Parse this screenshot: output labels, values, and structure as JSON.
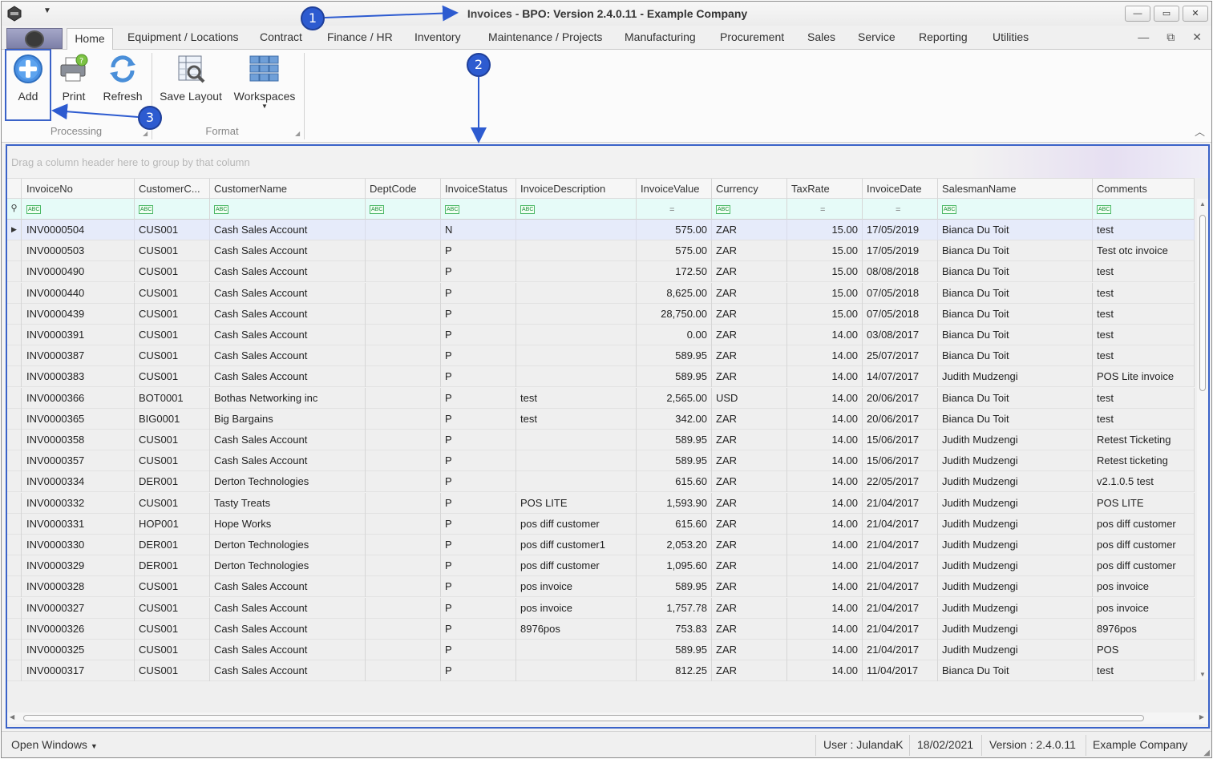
{
  "window": {
    "title_prefix": "Invoices - ",
    "title_rest": "BPO: Version 2.4.0.11 - Example Company",
    "min_symbol": "—",
    "max_symbol": "▭",
    "close_symbol": "✕"
  },
  "tabs": {
    "home": "Home",
    "equipment": "Equipment / Locations",
    "contract": "Contract",
    "finance": "Finance / HR",
    "inventory": "Inventory",
    "maintenance": "Maintenance / Projects",
    "manufacturing": "Manufacturing",
    "procurement": "Procurement",
    "sales": "Sales",
    "service": "Service",
    "reporting": "Reporting",
    "utilities": "Utilities"
  },
  "ribbon": {
    "add": "Add",
    "print": "Print",
    "refresh": "Refresh",
    "save_layout": "Save Layout",
    "workspaces": "Workspaces",
    "group_processing": "Processing",
    "group_format": "Format"
  },
  "grid": {
    "group_hint": "Drag a column header here to group by that column",
    "columns": [
      "InvoiceNo",
      "CustomerC...",
      "CustomerName",
      "DeptCode",
      "InvoiceStatus",
      "InvoiceDescription",
      "InvoiceValue",
      "Currency",
      "TaxRate",
      "InvoiceDate",
      "SalesmanName",
      "Comments"
    ],
    "rows": [
      [
        "INV0000504",
        "CUS001",
        "Cash Sales Account",
        "",
        "N",
        "",
        "575.00",
        "ZAR",
        "15.00",
        "17/05/2019",
        "Bianca Du Toit",
        "test"
      ],
      [
        "INV0000503",
        "CUS001",
        "Cash Sales Account",
        "",
        "P",
        "",
        "575.00",
        "ZAR",
        "15.00",
        "17/05/2019",
        "Bianca Du Toit",
        "Test otc invoice"
      ],
      [
        "INV0000490",
        "CUS001",
        "Cash Sales Account",
        "",
        "P",
        "",
        "172.50",
        "ZAR",
        "15.00",
        "08/08/2018",
        "Bianca Du Toit",
        "test"
      ],
      [
        "INV0000440",
        "CUS001",
        "Cash Sales Account",
        "",
        "P",
        "",
        "8,625.00",
        "ZAR",
        "15.00",
        "07/05/2018",
        "Bianca Du Toit",
        "test"
      ],
      [
        "INV0000439",
        "CUS001",
        "Cash Sales Account",
        "",
        "P",
        "",
        "28,750.00",
        "ZAR",
        "15.00",
        "07/05/2018",
        "Bianca Du Toit",
        "test"
      ],
      [
        "INV0000391",
        "CUS001",
        "Cash Sales Account",
        "",
        "P",
        "",
        "0.00",
        "ZAR",
        "14.00",
        "03/08/2017",
        "Bianca Du Toit",
        "test"
      ],
      [
        "INV0000387",
        "CUS001",
        "Cash Sales Account",
        "",
        "P",
        "",
        "589.95",
        "ZAR",
        "14.00",
        "25/07/2017",
        "Bianca Du Toit",
        "test"
      ],
      [
        "INV0000383",
        "CUS001",
        "Cash Sales Account",
        "",
        "P",
        "",
        "589.95",
        "ZAR",
        "14.00",
        "14/07/2017",
        "Judith Mudzengi",
        "POS Lite invoice"
      ],
      [
        "INV0000366",
        "BOT0001",
        "Bothas Networking inc",
        "",
        "P",
        "test",
        "2,565.00",
        "USD",
        "14.00",
        "20/06/2017",
        "Bianca Du Toit",
        "test"
      ],
      [
        "INV0000365",
        "BIG0001",
        "Big Bargains",
        "",
        "P",
        "test",
        "342.00",
        "ZAR",
        "14.00",
        "20/06/2017",
        "Bianca Du Toit",
        "test"
      ],
      [
        "INV0000358",
        "CUS001",
        "Cash Sales Account",
        "",
        "P",
        "",
        "589.95",
        "ZAR",
        "14.00",
        "15/06/2017",
        "Judith Mudzengi",
        "Retest Ticketing"
      ],
      [
        "INV0000357",
        "CUS001",
        "Cash Sales Account",
        "",
        "P",
        "",
        "589.95",
        "ZAR",
        "14.00",
        "15/06/2017",
        "Judith Mudzengi",
        "Retest ticketing"
      ],
      [
        "INV0000334",
        "DER001",
        "Derton Technologies",
        "",
        "P",
        "",
        "615.60",
        "ZAR",
        "14.00",
        "22/05/2017",
        "Judith Mudzengi",
        "v2.1.0.5 test"
      ],
      [
        "INV0000332",
        "CUS001",
        "Tasty Treats",
        "",
        "P",
        "POS LITE",
        "1,593.90",
        "ZAR",
        "14.00",
        "21/04/2017",
        "Judith Mudzengi",
        "POS LITE"
      ],
      [
        "INV0000331",
        "HOP001",
        "Hope Works",
        "",
        "P",
        "pos diff customer",
        "615.60",
        "ZAR",
        "14.00",
        "21/04/2017",
        "Judith Mudzengi",
        "pos diff customer"
      ],
      [
        "INV0000330",
        "DER001",
        "Derton Technologies",
        "",
        "P",
        "pos diff customer1",
        "2,053.20",
        "ZAR",
        "14.00",
        "21/04/2017",
        "Judith Mudzengi",
        "pos diff customer"
      ],
      [
        "INV0000329",
        "DER001",
        "Derton Technologies",
        "",
        "P",
        "pos diff customer",
        "1,095.60",
        "ZAR",
        "14.00",
        "21/04/2017",
        "Judith Mudzengi",
        "pos diff customer"
      ],
      [
        "INV0000328",
        "CUS001",
        "Cash Sales Account",
        "",
        "P",
        "pos invoice",
        "589.95",
        "ZAR",
        "14.00",
        "21/04/2017",
        "Judith Mudzengi",
        "pos invoice"
      ],
      [
        "INV0000327",
        "CUS001",
        "Cash Sales Account",
        "",
        "P",
        "pos invoice",
        "1,757.78",
        "ZAR",
        "14.00",
        "21/04/2017",
        "Judith Mudzengi",
        "pos invoice"
      ],
      [
        "INV0000326",
        "CUS001",
        "Cash Sales Account",
        "",
        "P",
        "8976pos",
        "753.83",
        "ZAR",
        "14.00",
        "21/04/2017",
        "Judith Mudzengi",
        "8976pos"
      ],
      [
        "INV0000325",
        "CUS001",
        "Cash Sales Account",
        "",
        "P",
        "",
        "589.95",
        "ZAR",
        "14.00",
        "21/04/2017",
        "Judith Mudzengi",
        "POS"
      ],
      [
        "INV0000317",
        "CUS001",
        "Cash Sales Account",
        "",
        "P",
        "",
        "812.25",
        "ZAR",
        "14.00",
        "11/04/2017",
        "Bianca Du Toit",
        "test"
      ]
    ],
    "filter_icons": [
      "abc",
      "abc",
      "abc",
      "abc",
      "abc",
      "abc",
      "equals",
      "abc",
      "equals",
      "equals",
      "abc",
      "abc"
    ],
    "selected_row": 0
  },
  "status": {
    "open_windows": "Open Windows",
    "user": "User : JulandaK",
    "date": "18/02/2021",
    "version": "Version : 2.4.0.11",
    "company": "Example Company"
  },
  "callouts": {
    "c1": "1",
    "c2": "2",
    "c3": "3"
  },
  "colors": {
    "accent": "#3a62c8",
    "filter_row": "#e6fbf8",
    "selected_row": "#e6ebfa"
  }
}
